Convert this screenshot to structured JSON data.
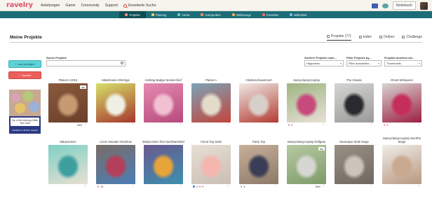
{
  "topbar": {
    "logo": "ravelry",
    "nav": [
      "Anleitungen",
      "Game",
      "Community",
      "Support"
    ],
    "search_label": "Erweiterte Suche",
    "notebook_label": "Notizbuch"
  },
  "subnav": [
    {
      "label": "Projekte",
      "color": "#f08a7a",
      "active": true
    },
    {
      "label": "Planung",
      "color": "#f2c46b"
    },
    {
      "label": "Vorrat",
      "color": "#6fc6c9"
    },
    {
      "label": "Garnproben",
      "color": "#f3885c"
    },
    {
      "label": "Werkzeuge",
      "color": "#f0a458"
    },
    {
      "label": "Favoriten",
      "color": "#ef6b6b"
    },
    {
      "label": "Bibliothek",
      "color": "#7ab6e6"
    }
  ],
  "page": {
    "title": "Meine Projekte",
    "tabs": [
      {
        "label": "Projekte (77)",
        "active": true
      },
      {
        "label": "Index"
      },
      {
        "label": "Ordner"
      },
      {
        "label": "Challenge"
      }
    ]
  },
  "sidebar": {
    "add_label": "add a project",
    "stash_label": "Suchen",
    "ad_text": "Top of the Morning Glitter\nYarn Sale",
    "ad_foot": "Available in all fiber weights"
  },
  "filters": {
    "search_label": "Suche Projekte",
    "search_placeholder": "",
    "sort_label": "Sortiere Projekte nach...",
    "sort_value": "Happiness",
    "filter_label": "Filter Projects by...",
    "filter_value": "Filter auswählen...",
    "view_label": "Projekte ansehen als...",
    "view_value": "Thumbnails"
  },
  "projects": [
    {
      "title": "Planet A 2015",
      "badge": "wip",
      "footer": "35%",
      "colors": [
        "#8a5a3c",
        "#c79a72",
        "#6b3f2a"
      ],
      "heart": ""
    },
    {
      "title": "Häkelrosen-Ohrringe",
      "badge": "",
      "footer": "",
      "colors": [
        "#d7e06a",
        "#f0efe4",
        "#a6372c"
      ],
      "heart": ""
    },
    {
      "title": "Knitting Badge Neckerchief",
      "badge": "",
      "footer": "",
      "colors": [
        "#e48bb0",
        "#f3c0d3",
        "#b64a7c"
      ],
      "heart": ""
    },
    {
      "title": "Planet A",
      "badge": "",
      "footer": "",
      "colors": [
        "#7aa3b8",
        "#e4dccb",
        "#c3453b"
      ],
      "heart": ""
    },
    {
      "title": "Glücksschwammerl",
      "badge": "",
      "footer": "",
      "colors": [
        "#efe9e5",
        "#d7d0ca",
        "#b33c32"
      ],
      "heart": ""
    },
    {
      "title": "Sassyclassycroptop",
      "badge": "",
      "footer": "",
      "colors": [
        "#9fb583",
        "#c64a7c",
        "#e8e0d6"
      ],
      "heart": "2"
    },
    {
      "title": "The Classic",
      "badge": "",
      "footer": "",
      "colors": [
        "#d5d5d3",
        "#2a2a2e",
        "#9b9a98"
      ],
      "heart": ""
    },
    {
      "title": "Ghost Whisperer",
      "badge": "",
      "footer": "",
      "colors": [
        "#d8d4d2",
        "#c62e5a",
        "#9d1f42"
      ],
      "heart": "2"
    },
    {
      "title": "babysocken",
      "badge": "",
      "footer": "",
      "colors": [
        "#7fd0c5",
        "#3e9f9f",
        "#e7e0d1"
      ],
      "heart": ""
    },
    {
      "title": "Lizzie Sweater Rainbow",
      "badge": "",
      "footer": "",
      "colors": [
        "#7a6d68",
        "#b33f5b",
        "#4a7eb5"
      ],
      "heart": "10"
    },
    {
      "title": "Babysocken fürs Nachbarskind",
      "badge": "",
      "footer": "",
      "colors": [
        "#6a5a8d",
        "#e7a43a",
        "#3c8fb0"
      ],
      "heart": ""
    },
    {
      "title": "Cinna Top Satin",
      "badge": "",
      "footer": "",
      "colors": [
        "#e7dfd6",
        "#f5b6ae",
        "#c9beb2"
      ],
      "heart": "9",
      "square": "2"
    },
    {
      "title": "Party Top",
      "badge": "",
      "footer": "",
      "colors": [
        "#c8b09a",
        "#3a3d55",
        "#8c7968"
      ],
      "heart": "4"
    },
    {
      "title": "Sassyclassycroptop hellgrau",
      "badge": "wip",
      "footer": "89%",
      "colors": [
        "#b7c9a3",
        "#d6d6d2",
        "#7e9b68"
      ],
      "heart": ""
    },
    {
      "title": "Seascape Stole beige",
      "badge": "",
      "footer": "",
      "colors": [
        "#9a9188",
        "#cbc4b9",
        "#6f675f"
      ],
      "heart": ""
    },
    {
      "title": "Sassyclassycroptop Seerthe beige",
      "badge": "",
      "footer": "",
      "colors": [
        "#f0ede8",
        "#c9a98f",
        "#b89880"
      ],
      "heart": ""
    }
  ]
}
